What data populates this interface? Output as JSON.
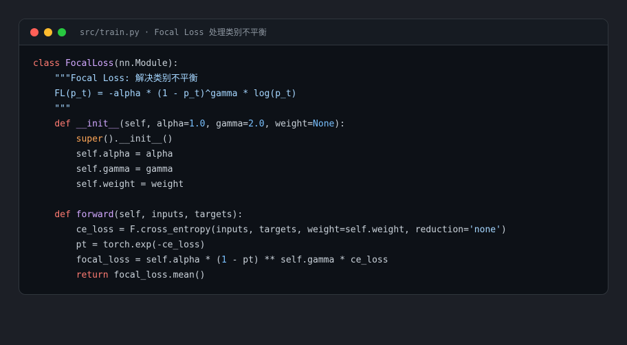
{
  "window": {
    "title": "src/train.py · Focal Loss 处理类别不平衡"
  },
  "colors": {
    "background": "#1c1f26",
    "editor": "#0d1117",
    "keyword": "#ff7b72",
    "function": "#d2a8ff",
    "number": "#79c0ff",
    "string": "#a5d6ff",
    "builtin": "#ffa657",
    "text": "#c9d1d9"
  },
  "code": {
    "lines": [
      [
        {
          "t": "kw",
          "v": "class"
        },
        {
          "t": "plain",
          "v": " "
        },
        {
          "t": "cls",
          "v": "FocalLoss"
        },
        {
          "t": "plain",
          "v": "(nn.Module):"
        }
      ],
      [
        {
          "t": "plain",
          "v": "    "
        },
        {
          "t": "str",
          "v": "\"\"\"Focal Loss: 解决类别不平衡"
        }
      ],
      [
        {
          "t": "str",
          "v": "    FL(p_t) = -alpha * (1 - p_t)^gamma * log(p_t)"
        }
      ],
      [
        {
          "t": "str",
          "v": "    \"\"\""
        }
      ],
      [
        {
          "t": "plain",
          "v": "    "
        },
        {
          "t": "kw",
          "v": "def"
        },
        {
          "t": "plain",
          "v": " "
        },
        {
          "t": "fn",
          "v": "__init__"
        },
        {
          "t": "plain",
          "v": "(self, alpha="
        },
        {
          "t": "num",
          "v": "1.0"
        },
        {
          "t": "plain",
          "v": ", gamma="
        },
        {
          "t": "num",
          "v": "2.0"
        },
        {
          "t": "plain",
          "v": ", weight="
        },
        {
          "t": "const",
          "v": "None"
        },
        {
          "t": "plain",
          "v": "):"
        }
      ],
      [
        {
          "t": "plain",
          "v": "        "
        },
        {
          "t": "builtin",
          "v": "super"
        },
        {
          "t": "plain",
          "v": "().__init__()"
        }
      ],
      [
        {
          "t": "plain",
          "v": "        self.alpha = alpha"
        }
      ],
      [
        {
          "t": "plain",
          "v": "        self.gamma = gamma"
        }
      ],
      [
        {
          "t": "plain",
          "v": "        self.weight = weight"
        }
      ],
      [],
      [
        {
          "t": "plain",
          "v": "    "
        },
        {
          "t": "kw",
          "v": "def"
        },
        {
          "t": "plain",
          "v": " "
        },
        {
          "t": "fn",
          "v": "forward"
        },
        {
          "t": "plain",
          "v": "(self, inputs, targets):"
        }
      ],
      [
        {
          "t": "plain",
          "v": "        ce_loss = F.cross_entropy(inputs, targets, weight=self.weight, reduction="
        },
        {
          "t": "str",
          "v": "'none'"
        },
        {
          "t": "plain",
          "v": ")"
        }
      ],
      [
        {
          "t": "plain",
          "v": "        pt = torch.exp(-ce_loss)"
        }
      ],
      [
        {
          "t": "plain",
          "v": "        focal_loss = self.alpha * ("
        },
        {
          "t": "num",
          "v": "1"
        },
        {
          "t": "plain",
          "v": " - pt) ** self.gamma * ce_loss"
        }
      ],
      [
        {
          "t": "plain",
          "v": "        "
        },
        {
          "t": "kw",
          "v": "return"
        },
        {
          "t": "plain",
          "v": " focal_loss.mean()"
        }
      ]
    ]
  }
}
